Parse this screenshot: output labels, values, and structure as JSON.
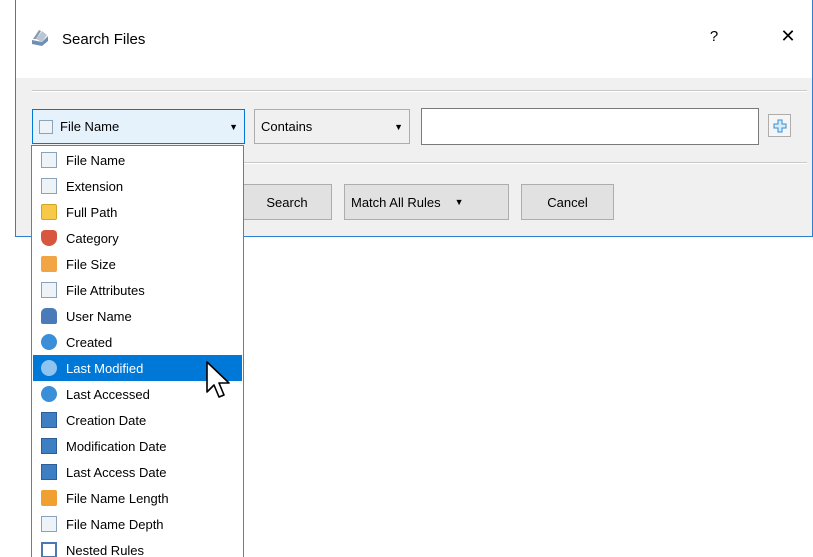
{
  "window": {
    "title": "Search Files",
    "help": "?",
    "close": "✕"
  },
  "rule": {
    "field_value": "File Name",
    "operator_value": "Contains",
    "text_value": ""
  },
  "buttons": {
    "search": "Search",
    "match_mode": "Match All Rules",
    "cancel": "Cancel"
  },
  "dropdown_items": [
    {
      "label": "File Name",
      "icon": "file-name-icon"
    },
    {
      "label": "Extension",
      "icon": "extension-icon"
    },
    {
      "label": "Full Path",
      "icon": "folder-icon"
    },
    {
      "label": "Category",
      "icon": "category-icon"
    },
    {
      "label": "File Size",
      "icon": "file-size-icon"
    },
    {
      "label": "File Attributes",
      "icon": "file-attributes-icon"
    },
    {
      "label": "User Name",
      "icon": "user-icon"
    },
    {
      "label": "Created",
      "icon": "clock-icon"
    },
    {
      "label": "Last Modified",
      "icon": "clock-icon",
      "selected": true
    },
    {
      "label": "Last Accessed",
      "icon": "clock-icon"
    },
    {
      "label": "Creation Date",
      "icon": "calendar-icon"
    },
    {
      "label": "Modification Date",
      "icon": "calendar-icon"
    },
    {
      "label": "Last Access Date",
      "icon": "calendar-icon"
    },
    {
      "label": "File Name Length",
      "icon": "length-icon"
    },
    {
      "label": "File Name Depth",
      "icon": "depth-icon"
    },
    {
      "label": "Nested Rules",
      "icon": "nested-rules-icon"
    }
  ],
  "colors": {
    "accent": "#0078d7",
    "window_border": "#2f7fd0",
    "dialog_bg": "#f0f0f0"
  }
}
